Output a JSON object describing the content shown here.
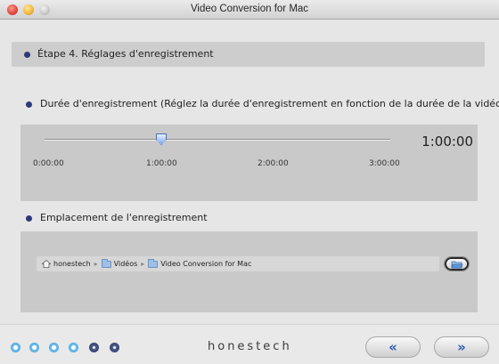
{
  "window": {
    "title": "Video Conversion for Mac"
  },
  "step": {
    "title": "Étape 4. Réglages d'enregistrement"
  },
  "duration": {
    "label": "Durée d'enregistrement (Réglez la durée d'enregistrement en fonction de la durée de la vidéo)",
    "value_display": "1:00:00",
    "ticks": [
      "0:00:00",
      "1:00:00",
      "2:00:00",
      "3:00:00"
    ],
    "slider_value": "1:00:00"
  },
  "location": {
    "label": "Emplacement de l'enregistrement",
    "path": [
      "honestech",
      "Vidéos",
      "Video Conversion for Mac"
    ],
    "separator": "▸"
  },
  "footer": {
    "brand": "honestech",
    "progress_steps": [
      "active",
      "active",
      "active",
      "active",
      "inactive",
      "inactive"
    ],
    "back_label": "«",
    "next_label": "»"
  },
  "colors": {
    "accent": "#2b57b8",
    "bullet": "#2e3a78",
    "panel": "#c9c9c9"
  },
  "icons": [
    "close-icon",
    "minimize-icon",
    "maximize-icon",
    "home-icon",
    "folder-icon",
    "browse-folder-icon"
  ]
}
